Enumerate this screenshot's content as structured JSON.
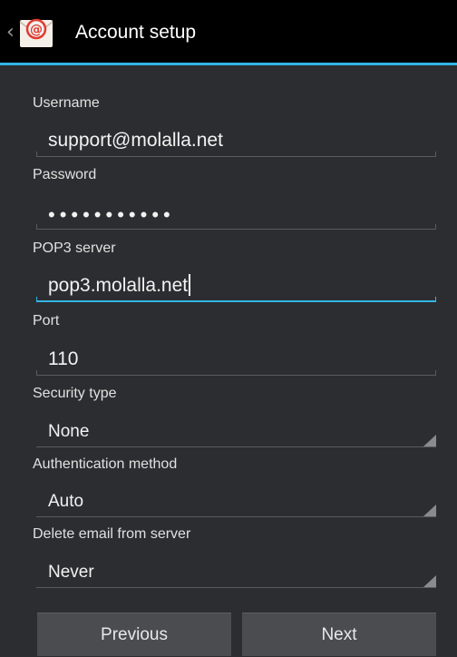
{
  "actionbar": {
    "title": "Account setup",
    "app_icon": "email-at-icon",
    "up_icon": "up-caret-icon"
  },
  "form": {
    "username_label": "Username",
    "username_value": "support@molalla.net",
    "password_label": "Password",
    "password_value": "•••••••••••",
    "pop3_label": "POP3 server",
    "pop3_value": "pop3.molalla.net",
    "port_label": "Port",
    "port_value": "110",
    "security_label": "Security type",
    "security_value": "None",
    "auth_label": "Authentication method",
    "auth_value": "Auto",
    "delete_label": "Delete email from server",
    "delete_value": "Never"
  },
  "buttons": {
    "previous": "Previous",
    "next": "Next"
  },
  "colors": {
    "accent": "#33b5e5",
    "background": "#2c2d30",
    "actionbar": "#000000"
  }
}
